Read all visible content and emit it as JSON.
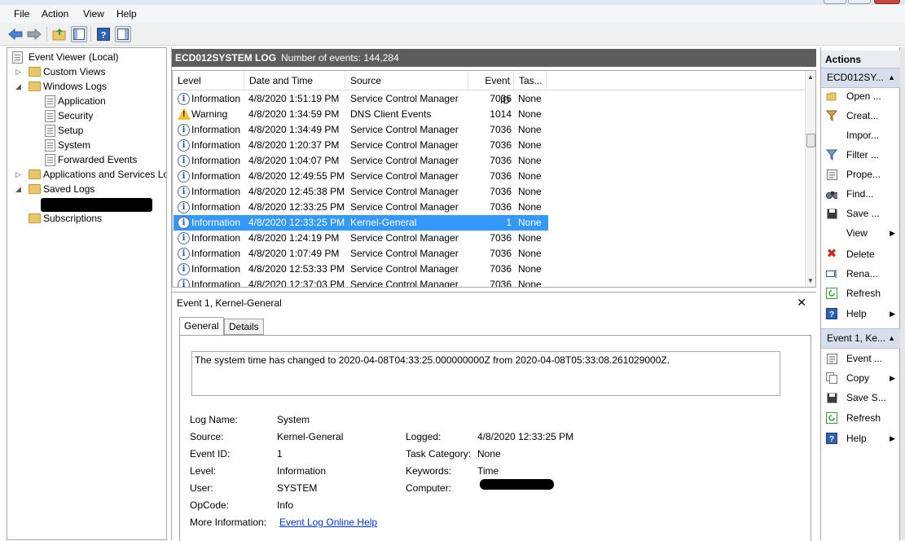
{
  "menu": [
    "File",
    "Action",
    "View",
    "Help"
  ],
  "tree": {
    "root": "Event Viewer (Local)",
    "items": [
      {
        "label": "Custom Views"
      },
      {
        "label": "Windows Logs"
      },
      {
        "label": "Application"
      },
      {
        "label": "Security"
      },
      {
        "label": "Setup"
      },
      {
        "label": "System"
      },
      {
        "label": "Forwarded Events"
      },
      {
        "label": "Applications and Services Lo"
      },
      {
        "label": "Saved Logs"
      },
      {
        "label": "Subscriptions"
      }
    ]
  },
  "log": {
    "name": "ECD012SYSTEM LOG",
    "count_text": "Number of events: 144,284"
  },
  "grid": {
    "headers": [
      "Level",
      "Date and Time",
      "Source",
      "Event ID",
      "Tas..."
    ],
    "rows": [
      {
        "level": "Information",
        "date": "4/8/2020 1:51:19 PM",
        "source": "Service Control Manager",
        "id": "7036",
        "task": "None"
      },
      {
        "level": "Warning",
        "date": "4/8/2020 1:34:59 PM",
        "source": "DNS Client Events",
        "id": "1014",
        "task": "None"
      },
      {
        "level": "Information",
        "date": "4/8/2020 1:34:49 PM",
        "source": "Service Control Manager",
        "id": "7036",
        "task": "None"
      },
      {
        "level": "Information",
        "date": "4/8/2020 1:20:37 PM",
        "source": "Service Control Manager",
        "id": "7036",
        "task": "None"
      },
      {
        "level": "Information",
        "date": "4/8/2020 1:04:07 PM",
        "source": "Service Control Manager",
        "id": "7036",
        "task": "None"
      },
      {
        "level": "Information",
        "date": "4/8/2020 12:49:55 PM",
        "source": "Service Control Manager",
        "id": "7036",
        "task": "None"
      },
      {
        "level": "Information",
        "date": "4/8/2020 12:45:38 PM",
        "source": "Service Control Manager",
        "id": "7036",
        "task": "None"
      },
      {
        "level": "Information",
        "date": "4/8/2020 12:33:25 PM",
        "source": "Service Control Manager",
        "id": "7036",
        "task": "None"
      },
      {
        "level": "Information",
        "date": "4/8/2020 12:33:25 PM",
        "source": "Kernel-General",
        "id": "1",
        "task": "None"
      },
      {
        "level": "Information",
        "date": "4/8/2020 1:24:19 PM",
        "source": "Service Control Manager",
        "id": "7036",
        "task": "None"
      },
      {
        "level": "Information",
        "date": "4/8/2020 1:07:49 PM",
        "source": "Service Control Manager",
        "id": "7036",
        "task": "None"
      },
      {
        "level": "Information",
        "date": "4/8/2020 12:53:33 PM",
        "source": "Service Control Manager",
        "id": "7036",
        "task": "None"
      },
      {
        "level": "Information",
        "date": "4/8/2020 12:37:03 PM",
        "source": "Service Control Manager",
        "id": "7036",
        "task": "None"
      }
    ]
  },
  "detail": {
    "title": "Event 1, Kernel-General",
    "tabs": [
      "General",
      "Details"
    ],
    "message": "The system time has changed to 2020-04-08T04:33:25.000000000Z from 2020-04-08T05:33:08.261029000Z.",
    "labels": {
      "log_name": "Log Name:",
      "source": "Source:",
      "event_id": "Event ID:",
      "level": "Level:",
      "user": "User:",
      "opcode": "OpCode:",
      "more_info": "More Information:",
      "logged": "Logged:",
      "task_category": "Task Category:",
      "keywords": "Keywords:",
      "computer": "Computer:"
    },
    "values": {
      "log_name": "System",
      "source": "Kernel-General",
      "event_id": "1",
      "level": "Information",
      "user": "SYSTEM",
      "opcode": "Info",
      "more_info": "Event Log Online Help",
      "logged": "4/8/2020 12:33:25 PM",
      "task_category": "None",
      "keywords": "Time"
    }
  },
  "actions": {
    "header": "Actions",
    "section1": "ECD012SY...",
    "items1": [
      "Open ...",
      "Creat...",
      "Impor...",
      "Filter ...",
      "Prope...",
      "Find...",
      "Save ...",
      "View",
      "Delete",
      "Rena...",
      "Refresh",
      "Help"
    ],
    "section2": "Event 1, Ke...",
    "items2": [
      "Event ...",
      "Copy",
      "Save S...",
      "Refresh",
      "Help"
    ]
  }
}
